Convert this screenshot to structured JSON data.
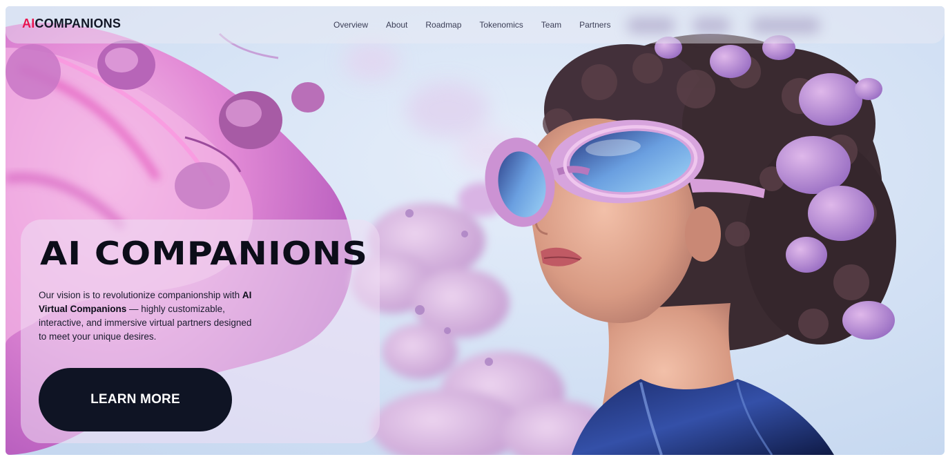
{
  "header": {
    "brand_accent": "AI",
    "brand_rest": "COMPANIONS",
    "nav": [
      {
        "label": "Overview"
      },
      {
        "label": "About"
      },
      {
        "label": "Roadmap"
      },
      {
        "label": "Tokenomics"
      },
      {
        "label": "Team"
      },
      {
        "label": "Partners"
      }
    ]
  },
  "hero": {
    "title": "AI COMPANIONS",
    "description_lead": "Our vision is to revolutionize companionship with ",
    "description_strong": "AI Virtual Companions",
    "description_tail": " — highly customizable, interactive, and immersive virtual partners designed to meet your unique desires.",
    "cta_label": "LEARN MORE"
  },
  "colors": {
    "brand_accent": "#e8154f",
    "brand_text": "#131726",
    "button_bg": "#0f1424",
    "button_text": "#ffffff",
    "sky": "#cfdff3",
    "card_bg": "#eedef4"
  },
  "icons": {
    "hero_visual": "woman-with-vr-goggles-illustration"
  }
}
